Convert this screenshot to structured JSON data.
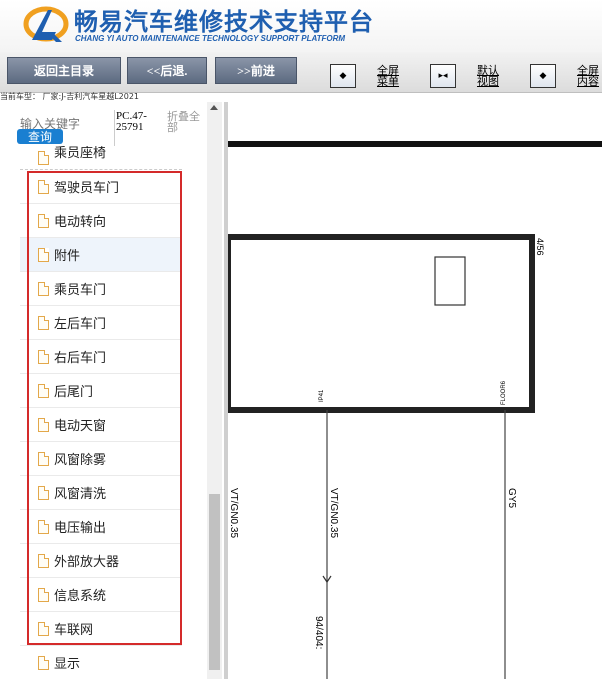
{
  "header": {
    "title_cn": "畅易汽车维修技术支持平台",
    "title_en": "CHANG YI AUTO MAINTENANCE TECHNOLOGY SUPPORT PLATFORM"
  },
  "toolbar": {
    "back_main": "返回主目录",
    "back": "<<后退.",
    "forward": ">>前进",
    "fullscreen_menu": "全屏\n菜单",
    "default_view": "默认\n视图",
    "fullscreen_content": "全屏\n内容"
  },
  "vehicle": {
    "line": "当前车型： 厂家:J-吉利汽车星越L2021"
  },
  "sidebar": {
    "search_placeholder": "输入关键字",
    "search_button": "查询",
    "pc_code": "PC.47-25791",
    "collapse_all": "折叠全部",
    "partial_item": "乘员座椅",
    "items": [
      {
        "label": "驾驶员车门",
        "highlighted": false
      },
      {
        "label": "电动转向",
        "highlighted": false
      },
      {
        "label": "附件",
        "highlighted": true
      },
      {
        "label": "乘员车门",
        "highlighted": false
      },
      {
        "label": "左后车门",
        "highlighted": false
      },
      {
        "label": "右后车门",
        "highlighted": false
      },
      {
        "label": "后尾门",
        "highlighted": false
      },
      {
        "label": "电动天窗",
        "highlighted": false
      },
      {
        "label": "风窗除雾",
        "highlighted": false
      },
      {
        "label": "风窗清洗",
        "highlighted": false
      },
      {
        "label": "电压输出",
        "highlighted": false
      },
      {
        "label": "外部放大器",
        "highlighted": false
      },
      {
        "label": "信息系统",
        "highlighted": false
      },
      {
        "label": "车联网",
        "highlighted": false
      },
      {
        "label": "显示",
        "highlighted": false
      }
    ]
  },
  "diagram": {
    "connector_label": "4/56",
    "pin_left": "IP41",
    "pin_right": "FLOOR6",
    "wire_left": "VT/GN0.35",
    "wire_mid": "VT/GN0.35",
    "wire_right": "GY5",
    "bottom_label": "94/404:"
  },
  "colors": {
    "brand_blue": "#1f5fb0",
    "selection_box": "#d42a2a",
    "search_button": "#1a7fd1"
  }
}
